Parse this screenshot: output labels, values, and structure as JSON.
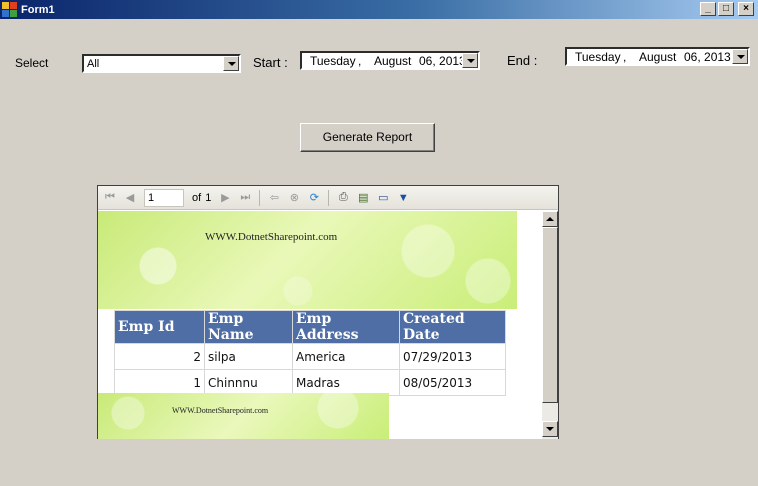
{
  "window": {
    "title": "Form1",
    "buttons": {
      "minimize": "_",
      "maximize": "□",
      "close": "×"
    }
  },
  "filters": {
    "select_label": "Select",
    "select_value": "All",
    "start_label": "Start :",
    "end_label": "End :",
    "start_date": {
      "day": "Tuesday",
      "sep": ",",
      "month": "August",
      "date": "06, 2013"
    },
    "end_date": {
      "day": "Tuesday",
      "sep": ",",
      "month": "August",
      "date": "06, 2013"
    }
  },
  "generate_button": "Generate Report",
  "report_viewer": {
    "toolbar": {
      "page_current": "1",
      "page_of": "of",
      "page_total": "1",
      "icons": [
        "first-page-icon",
        "prev-page-icon",
        "next-page-icon",
        "last-page-icon",
        "back-icon",
        "stop-icon",
        "refresh-icon",
        "print-icon",
        "print-layout-icon",
        "page-setup-icon",
        "export-save-icon"
      ]
    },
    "header_banner_text": "WWW.DotnetSharepoint.com",
    "footer_banner_text": "WWW.DotnetSharepoint.com",
    "table": {
      "columns": [
        "Emp Id",
        "Emp Name",
        "Emp Address",
        "Created Date"
      ],
      "rows": [
        [
          "2",
          "silpa",
          "America",
          "07/29/2013"
        ],
        [
          "1",
          "Chinnnu",
          "Madras",
          "08/05/2013"
        ]
      ]
    },
    "colors": {
      "header_bg": "#4f6ea5",
      "banner": "#c8ea78"
    }
  }
}
